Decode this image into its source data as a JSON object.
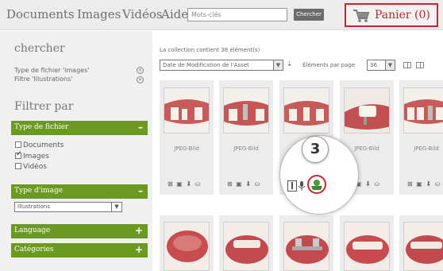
{
  "nav": {
    "documents": "Documents",
    "images": "Images",
    "videos": "Vidéos",
    "aide": "Aide",
    "search_placeholder": "Mots-clés",
    "search_button": "Chercher",
    "cart": "Panier (0)"
  },
  "sidebar": {
    "title": "chercher",
    "active_filters": [
      "Type de fichier 'images'",
      "Filtre 'Illustrations'"
    ],
    "filter_heading": "Filtrer par",
    "sections": [
      {
        "label": "Type de fichier",
        "sign": "–"
      },
      {
        "label": "Type d'image",
        "sign": "–"
      },
      {
        "label": "Language",
        "sign": "+"
      },
      {
        "label": "Catégories",
        "sign": "+"
      }
    ],
    "file_types": [
      {
        "label": "Documents",
        "checked": false
      },
      {
        "label": "Images",
        "checked": true
      },
      {
        "label": "Vidéos",
        "checked": false
      }
    ],
    "image_type_value": "Illustrations"
  },
  "main": {
    "collection_info": "La collection contient 38 élément(s)",
    "sort_value": "Date de Modification de l'Asset",
    "per_page_label": "Éléments par page",
    "per_page_value": "36"
  },
  "cards": [
    {
      "label": "JPEG-Bild",
      "actions": "⊠ ▣ ⬇ ⛀"
    },
    {
      "label": "JPEG-Bild",
      "actions": "⊠ ▣ ⬇ ⛀"
    },
    {
      "label": "JPEG-Bild",
      "actions": ""
    },
    {
      "label": "JPEG-Bild",
      "actions": "▣ ⬇ ⛀"
    },
    {
      "label": "JPEG-Bild",
      "actions": "⊠ ▣ ⬇ ⛀"
    }
  ],
  "callout": {
    "number": "3"
  },
  "colors": {
    "accent_green": "#6a9a1f",
    "highlight_red": "#c8262f"
  }
}
